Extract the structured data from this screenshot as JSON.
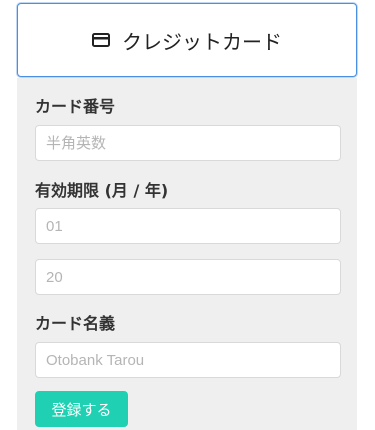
{
  "tab": {
    "icon": "credit-card-icon",
    "label": "クレジットカード"
  },
  "form": {
    "card_number": {
      "label": "カード番号",
      "placeholder": "半角英数"
    },
    "expiry": {
      "label": "有効期限 (月 / 年)",
      "month_placeholder": "01",
      "year_placeholder": "20"
    },
    "card_holder": {
      "label": "カード名義",
      "placeholder": "Otobank Tarou"
    },
    "submit_label": "登録する"
  },
  "colors": {
    "accent": "#1fd1b2",
    "focus_border": "#4a90e2",
    "panel_bg": "#efefef"
  }
}
